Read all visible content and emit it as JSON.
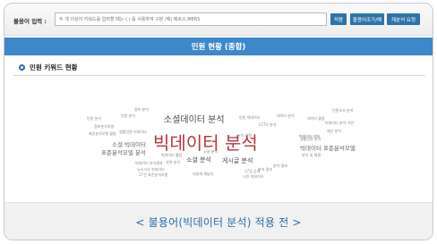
{
  "stopword_bar": {
    "label": "불용어 입력 :",
    "input_placeholder": "두 개 이상의 키워드를 입력할 때는 (,) 를 사용하여 구분 /예) 메르스,MERS",
    "apply_label": "적용",
    "manage_label": "불용어조가/해",
    "reanalyze_label": "재분석 요청"
  },
  "header": {
    "title": "민원 현황 (종합)"
  },
  "section": {
    "title": "민원 키워드 현황"
  },
  "word_cloud": {
    "words": [
      {
        "text": "빅데이터 분석",
        "color": "#b5373e"
      },
      {
        "text": "소셜데이터 분석",
        "color": "#4a4a4a"
      },
      {
        "text": "소셜 빅데이터",
        "color": "#666666"
      },
      {
        "text": "표준분석모델 분석",
        "color": "#666666"
      },
      {
        "text": "소셜 분석",
        "color": "#555555"
      },
      {
        "text": "게시글 분석",
        "color": "#555555"
      },
      {
        "text": "빅데이터 표준분석모델",
        "color": "#666666"
      },
      {
        "text": "빅데이터 센터",
        "color": "#777777"
      },
      {
        "text": "정보 분석",
        "color": "#888888"
      },
      {
        "text": "민원 분석",
        "color": "#888888"
      },
      {
        "text": "정보분석모델",
        "color": "#888888"
      },
      {
        "text": "표준분석모델 활용",
        "color": "#888888"
      },
      {
        "text": "생활민원 분석",
        "color": "#888888"
      },
      {
        "text": "데이터 분석",
        "color": "#888888"
      },
      {
        "text": "데이터 활용",
        "color": "#888888"
      },
      {
        "text": "민원조사 분석",
        "color": "#888888"
      },
      {
        "text": "분석 결과",
        "color": "#888888"
      },
      {
        "text": "CCTV 분석",
        "color": "#888888"
      },
      {
        "text": "재난 분석",
        "color": "#888888"
      },
      {
        "text": "분석 모형",
        "color": "#888888"
      },
      {
        "text": "빅데이터 활용",
        "color": "#888888"
      },
      {
        "text": "지역 분석",
        "color": "#888888"
      },
      {
        "text": "뉴스기사 빅데이터",
        "color": "#888888"
      },
      {
        "text": "17건 표준분석모델",
        "color": "#888888"
      },
      {
        "text": "지방세 체납자",
        "color": "#888888"
      },
      {
        "text": "17일 공개",
        "color": "#888888"
      },
      {
        "text": "분석 결과",
        "color": "#888888"
      },
      {
        "text": "민원 분석",
        "color": "#888888"
      },
      {
        "text": "빅데이터 분석결과",
        "color": "#888888"
      },
      {
        "text": "시민 빅데이터",
        "color": "#888888"
      },
      {
        "text": "분석 및 해결",
        "color": "#888888"
      },
      {
        "text": "소셜 분석",
        "color": "#888888"
      },
      {
        "text": "생활민원 빅데이터",
        "color": "#888888"
      },
      {
        "text": "민원 빅데이터",
        "color": "#888888"
      },
      {
        "text": "빅데이터 분석 기반",
        "color": "#888888"
      }
    ]
  },
  "caption": "< 불용어(빅데이터 분석) 적용 전 >"
}
